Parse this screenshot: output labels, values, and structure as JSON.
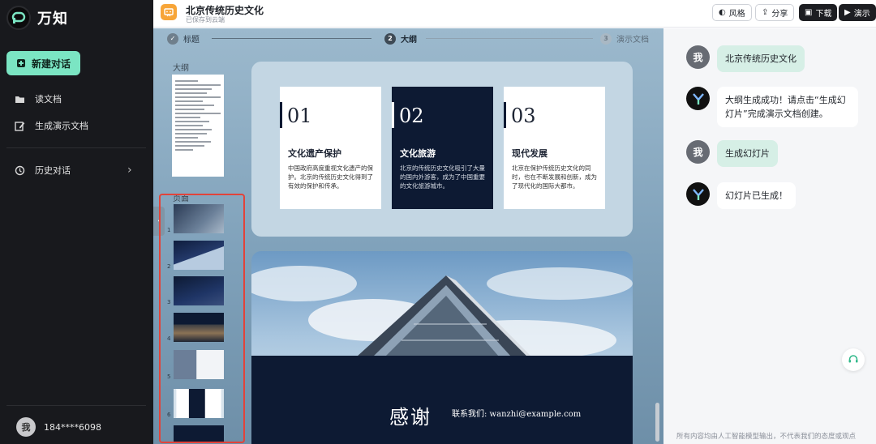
{
  "sidebar": {
    "brand": "万知",
    "new_chat": "新建对话",
    "items": [
      {
        "label": "读文档",
        "icon": "folder-icon"
      },
      {
        "label": "生成演示文档",
        "icon": "edit-icon"
      },
      {
        "label": "历史对话",
        "icon": "history-icon"
      }
    ],
    "user": {
      "avatar": "我",
      "phone": "184****6098"
    }
  },
  "header": {
    "title": "北京传统历史文化",
    "subtitle": "已保存到云端",
    "buttons": {
      "style": "风格",
      "share": "分享",
      "download": "下载",
      "present": "演示"
    }
  },
  "steps": [
    {
      "num": "1",
      "label": "标题",
      "state": "done"
    },
    {
      "num": "2",
      "label": "大纲",
      "state": "active"
    },
    {
      "num": "3",
      "label": "演示文档",
      "state": "pending"
    }
  ],
  "panel": {
    "outline_label": "大纲",
    "pages_label": "页面",
    "page_numbers": [
      "1",
      "2",
      "3",
      "4",
      "5",
      "6"
    ]
  },
  "slide1": {
    "cards": [
      {
        "num": "01",
        "title": "文化遗产保护",
        "desc": "中国政府高度重视文化遗产的保护。北京的传统历史文化得到了有效的保护和传承。",
        "theme": "light"
      },
      {
        "num": "02",
        "title": "文化旅游",
        "desc": "北京的传统历史文化吸引了大量的国内外游客，成为了中国重要的文化旅游城市。",
        "theme": "dark"
      },
      {
        "num": "03",
        "title": "现代发展",
        "desc": "北京在保护传统历史文化的同时，也在不断发展和创新，成为了现代化的国际大都市。",
        "theme": "light"
      }
    ]
  },
  "slide2": {
    "thanks": "感谢",
    "contact": "联系我们: wanzhi@example.com"
  },
  "chat": {
    "messages": [
      {
        "role": "user",
        "avatar": "我",
        "text": "北京传统历史文化"
      },
      {
        "role": "bot",
        "text": "大纲生成成功！请点击“生成幻灯片”完成演示文档创建。"
      },
      {
        "role": "user",
        "avatar": "我",
        "text": "生成幻灯片"
      },
      {
        "role": "bot",
        "text": "幻灯片已生成！"
      }
    ],
    "disclaimer": "所有内容均由人工智能模型输出，不代表我们的态度或观点"
  },
  "colors": {
    "accent": "#7be5c3",
    "sidebar_bg": "#18191d",
    "slide_dark": "#0d1a33",
    "highlight_border": "#e2433a"
  }
}
